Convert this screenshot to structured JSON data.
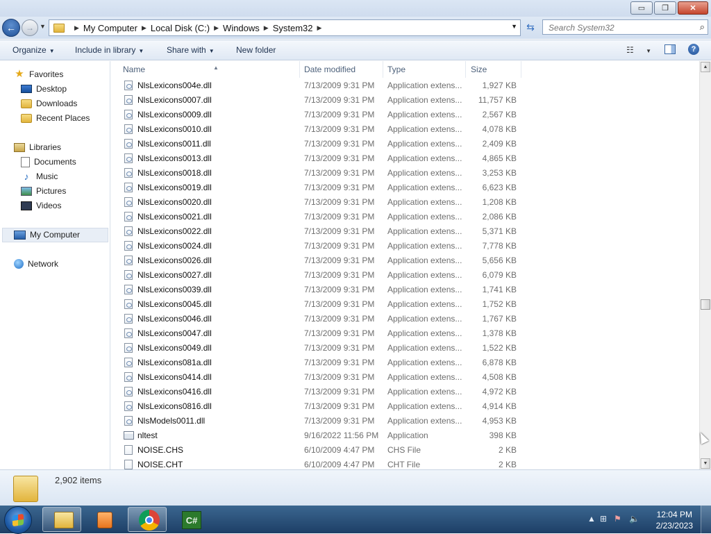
{
  "window": {
    "controls": {
      "minimize": "▭",
      "maximize": "❐",
      "close": "✕"
    }
  },
  "address_bar": {
    "breadcrumbs": [
      "My Computer",
      "Local Disk (C:)",
      "Windows",
      "System32"
    ],
    "search_placeholder": "Search System32"
  },
  "toolbar": {
    "organize": "Organize",
    "include_in_library": "Include in library",
    "share_with": "Share with",
    "new_folder": "New folder"
  },
  "nav_pane": {
    "favorites": "Favorites",
    "favorites_items": [
      "Desktop",
      "Downloads",
      "Recent Places"
    ],
    "libraries": "Libraries",
    "library_items": [
      "Documents",
      "Music",
      "Pictures",
      "Videos"
    ],
    "my_computer": "My Computer",
    "network": "Network"
  },
  "columns": {
    "name": "Name",
    "date_modified": "Date modified",
    "type": "Type",
    "size": "Size"
  },
  "files": [
    {
      "name": "NlsLexicons004e.dll",
      "date": "7/13/2009 9:31 PM",
      "type": "Application extens...",
      "size": "1,927 KB",
      "icon": "dll-icon"
    },
    {
      "name": "NlsLexicons0007.dll",
      "date": "7/13/2009 9:31 PM",
      "type": "Application extens...",
      "size": "11,757 KB",
      "icon": "dll-icon"
    },
    {
      "name": "NlsLexicons0009.dll",
      "date": "7/13/2009 9:31 PM",
      "type": "Application extens...",
      "size": "2,567 KB",
      "icon": "dll-icon"
    },
    {
      "name": "NlsLexicons0010.dll",
      "date": "7/13/2009 9:31 PM",
      "type": "Application extens...",
      "size": "4,078 KB",
      "icon": "dll-icon"
    },
    {
      "name": "NlsLexicons0011.dll",
      "date": "7/13/2009 9:31 PM",
      "type": "Application extens...",
      "size": "2,409 KB",
      "icon": "dll-icon"
    },
    {
      "name": "NlsLexicons0013.dll",
      "date": "7/13/2009 9:31 PM",
      "type": "Application extens...",
      "size": "4,865 KB",
      "icon": "dll-icon"
    },
    {
      "name": "NlsLexicons0018.dll",
      "date": "7/13/2009 9:31 PM",
      "type": "Application extens...",
      "size": "3,253 KB",
      "icon": "dll-icon"
    },
    {
      "name": "NlsLexicons0019.dll",
      "date": "7/13/2009 9:31 PM",
      "type": "Application extens...",
      "size": "6,623 KB",
      "icon": "dll-icon"
    },
    {
      "name": "NlsLexicons0020.dll",
      "date": "7/13/2009 9:31 PM",
      "type": "Application extens...",
      "size": "1,208 KB",
      "icon": "dll-icon"
    },
    {
      "name": "NlsLexicons0021.dll",
      "date": "7/13/2009 9:31 PM",
      "type": "Application extens...",
      "size": "2,086 KB",
      "icon": "dll-icon"
    },
    {
      "name": "NlsLexicons0022.dll",
      "date": "7/13/2009 9:31 PM",
      "type": "Application extens...",
      "size": "5,371 KB",
      "icon": "dll-icon"
    },
    {
      "name": "NlsLexicons0024.dll",
      "date": "7/13/2009 9:31 PM",
      "type": "Application extens...",
      "size": "7,778 KB",
      "icon": "dll-icon"
    },
    {
      "name": "NlsLexicons0026.dll",
      "date": "7/13/2009 9:31 PM",
      "type": "Application extens...",
      "size": "5,656 KB",
      "icon": "dll-icon"
    },
    {
      "name": "NlsLexicons0027.dll",
      "date": "7/13/2009 9:31 PM",
      "type": "Application extens...",
      "size": "6,079 KB",
      "icon": "dll-icon"
    },
    {
      "name": "NlsLexicons0039.dll",
      "date": "7/13/2009 9:31 PM",
      "type": "Application extens...",
      "size": "1,741 KB",
      "icon": "dll-icon"
    },
    {
      "name": "NlsLexicons0045.dll",
      "date": "7/13/2009 9:31 PM",
      "type": "Application extens...",
      "size": "1,752 KB",
      "icon": "dll-icon"
    },
    {
      "name": "NlsLexicons0046.dll",
      "date": "7/13/2009 9:31 PM",
      "type": "Application extens...",
      "size": "1,767 KB",
      "icon": "dll-icon"
    },
    {
      "name": "NlsLexicons0047.dll",
      "date": "7/13/2009 9:31 PM",
      "type": "Application extens...",
      "size": "1,378 KB",
      "icon": "dll-icon"
    },
    {
      "name": "NlsLexicons0049.dll",
      "date": "7/13/2009 9:31 PM",
      "type": "Application extens...",
      "size": "1,522 KB",
      "icon": "dll-icon"
    },
    {
      "name": "NlsLexicons081a.dll",
      "date": "7/13/2009 9:31 PM",
      "type": "Application extens...",
      "size": "6,878 KB",
      "icon": "dll-icon"
    },
    {
      "name": "NlsLexicons0414.dll",
      "date": "7/13/2009 9:31 PM",
      "type": "Application extens...",
      "size": "4,508 KB",
      "icon": "dll-icon"
    },
    {
      "name": "NlsLexicons0416.dll",
      "date": "7/13/2009 9:31 PM",
      "type": "Application extens...",
      "size": "4,972 KB",
      "icon": "dll-icon"
    },
    {
      "name": "NlsLexicons0816.dll",
      "date": "7/13/2009 9:31 PM",
      "type": "Application extens...",
      "size": "4,914 KB",
      "icon": "dll-icon"
    },
    {
      "name": "NlsModels0011.dll",
      "date": "7/13/2009 9:31 PM",
      "type": "Application extens...",
      "size": "4,953 KB",
      "icon": "dll-icon"
    },
    {
      "name": "nltest",
      "date": "9/16/2022 11:56 PM",
      "type": "Application",
      "size": "398 KB",
      "icon": "application-icon"
    },
    {
      "name": "NOISE.CHS",
      "date": "6/10/2009 4:47 PM",
      "type": "CHS File",
      "size": "2 KB",
      "icon": "file-icon"
    },
    {
      "name": "NOISE.CHT",
      "date": "6/10/2009 4:47 PM",
      "type": "CHT File",
      "size": "2 KB",
      "icon": "file-icon"
    }
  ],
  "status": {
    "item_count": "2,902 items"
  },
  "taskbar": {
    "apps": [
      "windows-explorer-icon",
      "media-player-icon",
      "chrome-icon",
      "csharp-ide-icon"
    ],
    "csharp_label": "C#",
    "time": "12:04 PM",
    "date": "2/23/2023"
  },
  "colors": {
    "accent": "#2f6bbf",
    "row_text": "#6d6d6d",
    "header_text": "#4c607a"
  }
}
